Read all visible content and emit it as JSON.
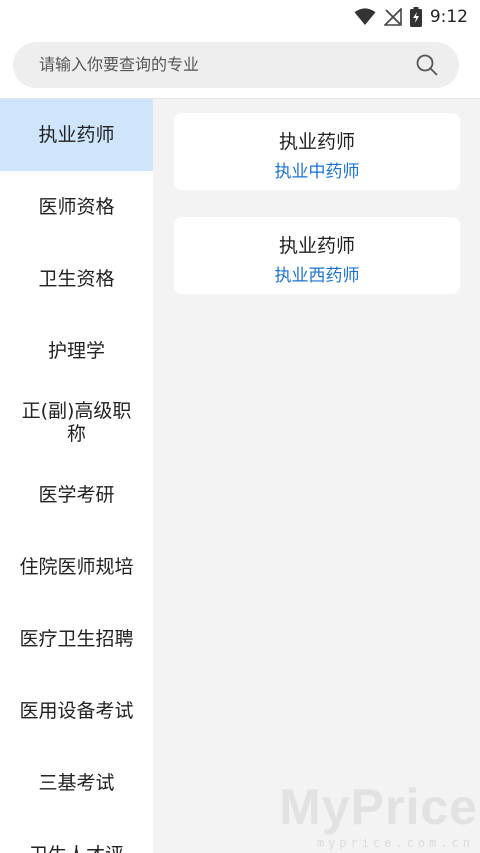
{
  "status": {
    "time": "9:12",
    "icons": [
      "wifi-icon",
      "signal-off-icon",
      "battery-charging-icon"
    ]
  },
  "search": {
    "placeholder": "请输入你要查询的专业",
    "icon": "search-icon"
  },
  "sidebar": {
    "active_color": "#cfe5fb",
    "items": [
      {
        "label": "执业药师"
      },
      {
        "label": "医师资格"
      },
      {
        "label": "卫生资格"
      },
      {
        "label": "护理学"
      },
      {
        "label": "正(副)高级职称"
      },
      {
        "label": "医学考研"
      },
      {
        "label": "住院医师规培"
      },
      {
        "label": "医疗卫生招聘"
      },
      {
        "label": "医用设备考试"
      },
      {
        "label": "三基考试"
      },
      {
        "label": "卫生人才评"
      }
    ]
  },
  "cards": [
    {
      "title": "执业药师",
      "subtitle": "执业中药师"
    },
    {
      "title": "执业药师",
      "subtitle": "执业西药师"
    }
  ],
  "colors": {
    "link": "#1a73d9",
    "content_bg": "#f3f3f3"
  },
  "watermark": {
    "big": "MyPrice",
    "small": "myprice.com.cn"
  }
}
